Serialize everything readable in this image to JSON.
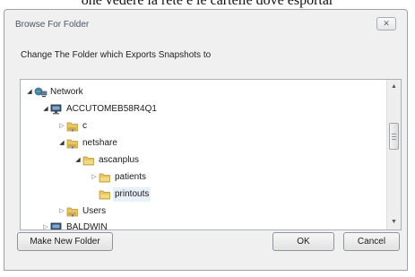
{
  "background_text": "one vedere la rete e le cartelle dove esportar",
  "dialog": {
    "title": "Browse For Folder",
    "close_label": "✕",
    "instruction": "Change The Folder which  Exports Snapshots to"
  },
  "tree": {
    "items": [
      {
        "label": "Network",
        "icon": "network-icon",
        "state": "expanded"
      },
      {
        "label": "ACCUTOMEB58R4Q1",
        "icon": "computer-icon",
        "state": "expanded"
      },
      {
        "label": "c",
        "icon": "shared-folder-icon",
        "state": "collapsed"
      },
      {
        "label": "netshare",
        "icon": "shared-folder-icon",
        "state": "expanded"
      },
      {
        "label": "ascanplus",
        "icon": "folder-icon",
        "state": "expanded"
      },
      {
        "label": "patients",
        "icon": "folder-icon",
        "state": "collapsed"
      },
      {
        "label": "printouts",
        "icon": "folder-icon",
        "state": "leaf",
        "selected": true
      },
      {
        "label": "Users",
        "icon": "shared-folder-icon",
        "state": "collapsed"
      },
      {
        "label": "BALDWIN",
        "icon": "computer-icon",
        "state": "collapsed"
      }
    ]
  },
  "buttons": {
    "new_folder": "Make New Folder",
    "ok": "OK",
    "cancel": "Cancel"
  },
  "colors": {
    "dialog_bg": "#f0f0f0",
    "folder": "#e8c760",
    "selection": "#e8f1fb"
  }
}
